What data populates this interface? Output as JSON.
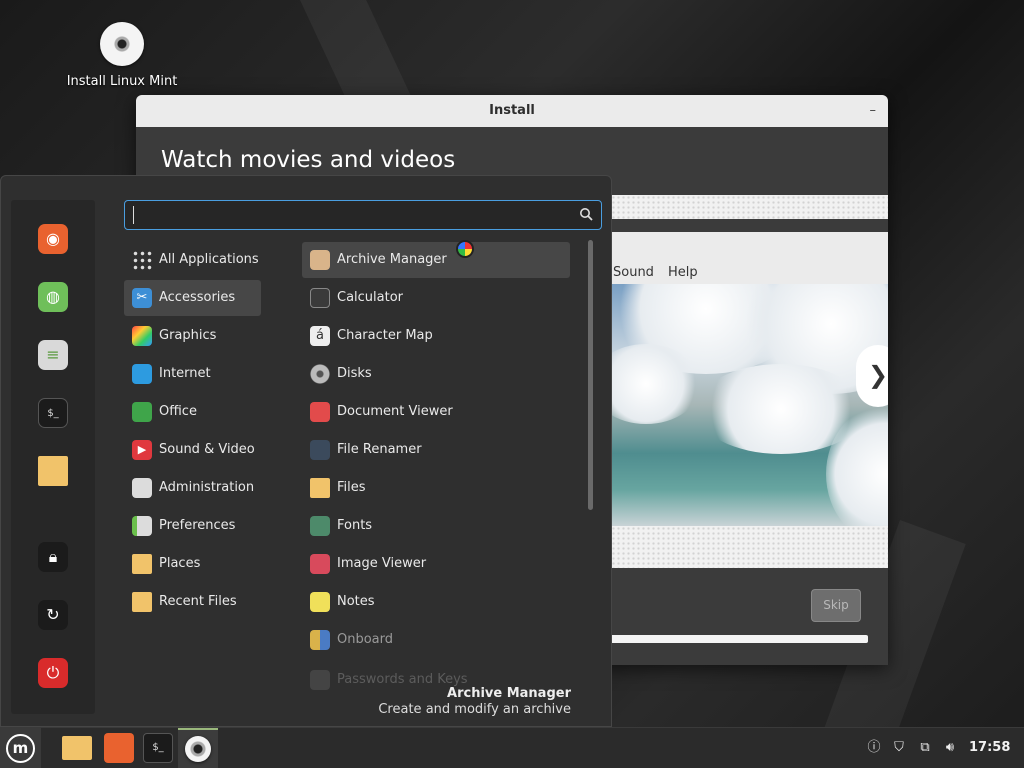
{
  "desktop": {
    "icon_label": "Install Linux Mint"
  },
  "install_window": {
    "title": "Install",
    "minimize_glyph": "–",
    "heading": "Watch movies and videos",
    "player_menu": [
      "Sound",
      "Help"
    ],
    "next_glyph": "❯",
    "skip_label": "Skip"
  },
  "menu": {
    "search_placeholder": "",
    "favorites": [
      "firefox-icon",
      "web-apps-icon",
      "settings-icon",
      "terminal-icon",
      "folder-icon",
      "lock-icon",
      "logout-icon",
      "power-icon"
    ],
    "categories": [
      {
        "label": "All Applications"
      },
      {
        "label": "Accessories",
        "selected": true
      },
      {
        "label": "Graphics"
      },
      {
        "label": "Internet"
      },
      {
        "label": "Office"
      },
      {
        "label": "Sound & Video"
      },
      {
        "label": "Administration"
      },
      {
        "label": "Preferences"
      },
      {
        "label": "Places"
      },
      {
        "label": "Recent Files"
      }
    ],
    "apps": [
      {
        "label": "Archive Manager",
        "selected": true
      },
      {
        "label": "Calculator"
      },
      {
        "label": "Character Map"
      },
      {
        "label": "Disks"
      },
      {
        "label": "Document Viewer"
      },
      {
        "label": "File Renamer"
      },
      {
        "label": "Files"
      },
      {
        "label": "Fonts"
      },
      {
        "label": "Image Viewer"
      },
      {
        "label": "Notes"
      },
      {
        "label": "Onboard"
      },
      {
        "label": "Passwords and Keys"
      }
    ],
    "description": {
      "title": "Archive Manager",
      "text": "Create and modify an archive"
    }
  },
  "panel": {
    "menu_logo": "m",
    "launchers": [
      "files-icon",
      "firefox-icon",
      "terminal-icon",
      "install-disc-icon"
    ],
    "terminal_glyph": "$_",
    "tray": [
      "update-manager-icon",
      "shield-icon",
      "network-icon",
      "volume-icon"
    ],
    "clock": "17:58"
  },
  "colors": {
    "accent": "#4a9ee0",
    "mint_green": "#9ab87c",
    "menu_bg": "#2f2f2f"
  }
}
